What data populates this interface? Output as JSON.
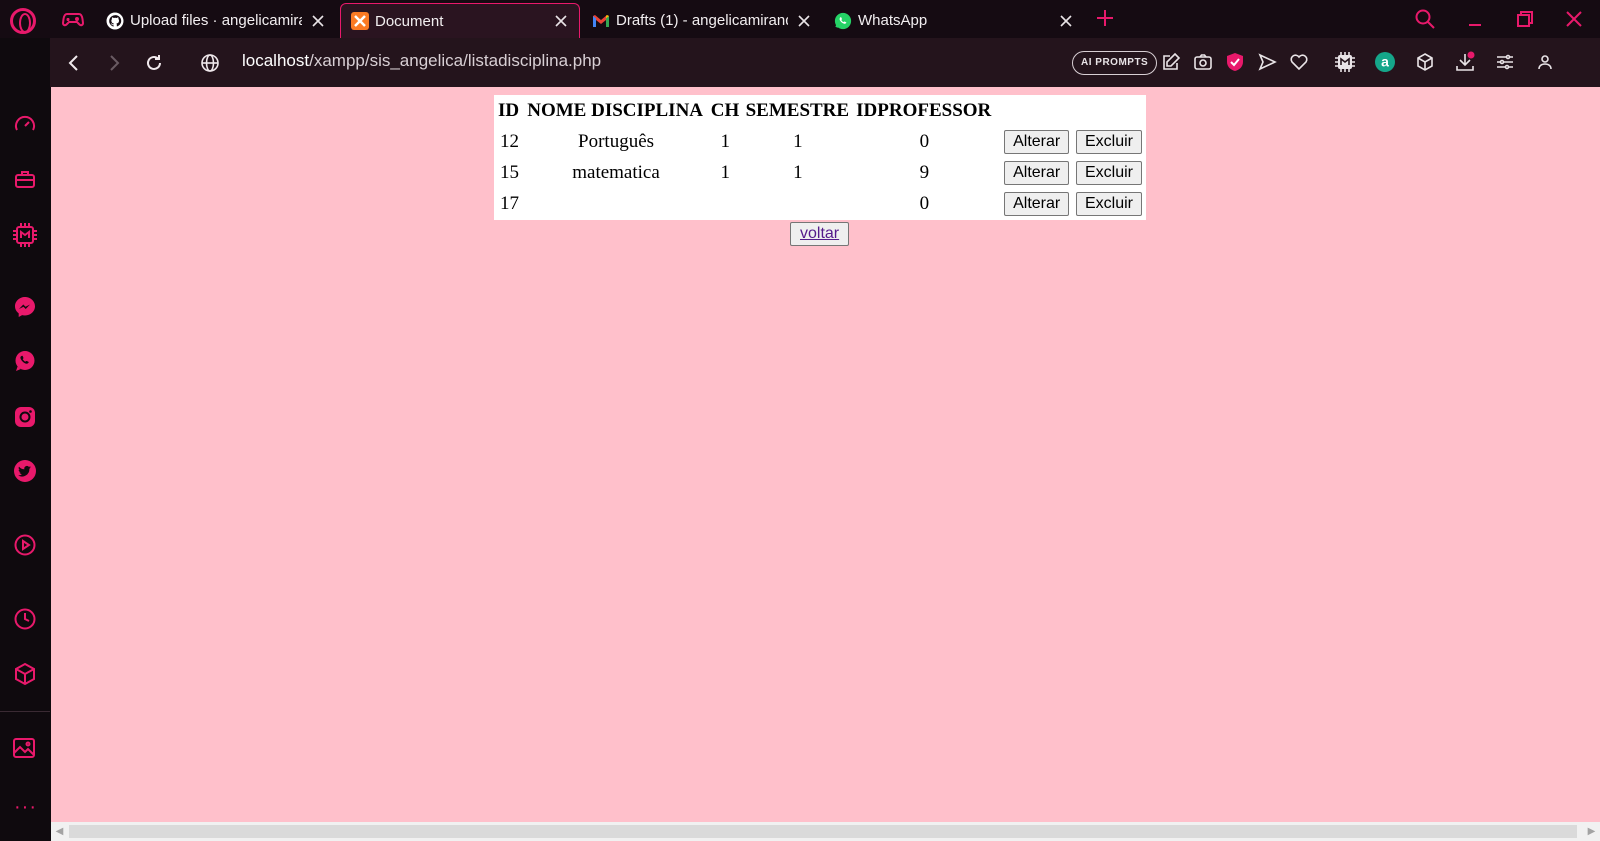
{
  "colors": {
    "accent": "#e8196b",
    "page_background": "#ffc0cb",
    "chrome_background": "#150b12",
    "toolbar_background": "#24141c"
  },
  "tabs": [
    {
      "icon": "github-icon",
      "title": "Upload files · angelicamiran",
      "active": false
    },
    {
      "icon": "xampp-icon",
      "title": "Document",
      "active": true
    },
    {
      "icon": "gmail-icon",
      "title": "Drafts (1) - angelicamirand",
      "active": false
    },
    {
      "icon": "whatsapp-icon",
      "title": "WhatsApp",
      "active": false
    }
  ],
  "address_bar": {
    "host": "localhost",
    "path": "/xampp/sis_angelica/listadisciplina.php"
  },
  "toolbar": {
    "ai_prompts_label": "AI PROMPTS"
  },
  "sidebar_icons": [
    "speed-dial-icon",
    "extensions-icon",
    "gx-control-icon",
    "messenger-icon",
    "whatsapp-icon",
    "instagram-icon",
    "twitter-icon",
    "player-icon",
    "history-icon",
    "cube-icon",
    "gallery-icon"
  ],
  "table": {
    "headers": [
      "ID",
      "NOME DISCIPLINA",
      "CH",
      "SEMESTRE",
      "IDPROFESSOR"
    ],
    "rows": [
      {
        "id": "12",
        "nome": "Português",
        "ch": "1",
        "semestre": "1",
        "idprofessor": "0"
      },
      {
        "id": "15",
        "nome": "matematica",
        "ch": "1",
        "semestre": "1",
        "idprofessor": "9"
      },
      {
        "id": "17",
        "nome": "",
        "ch": "",
        "semestre": "",
        "idprofessor": "0"
      }
    ],
    "alterar_label": "Alterar",
    "excluir_label": "Excluir"
  },
  "voltar_label": "voltar"
}
